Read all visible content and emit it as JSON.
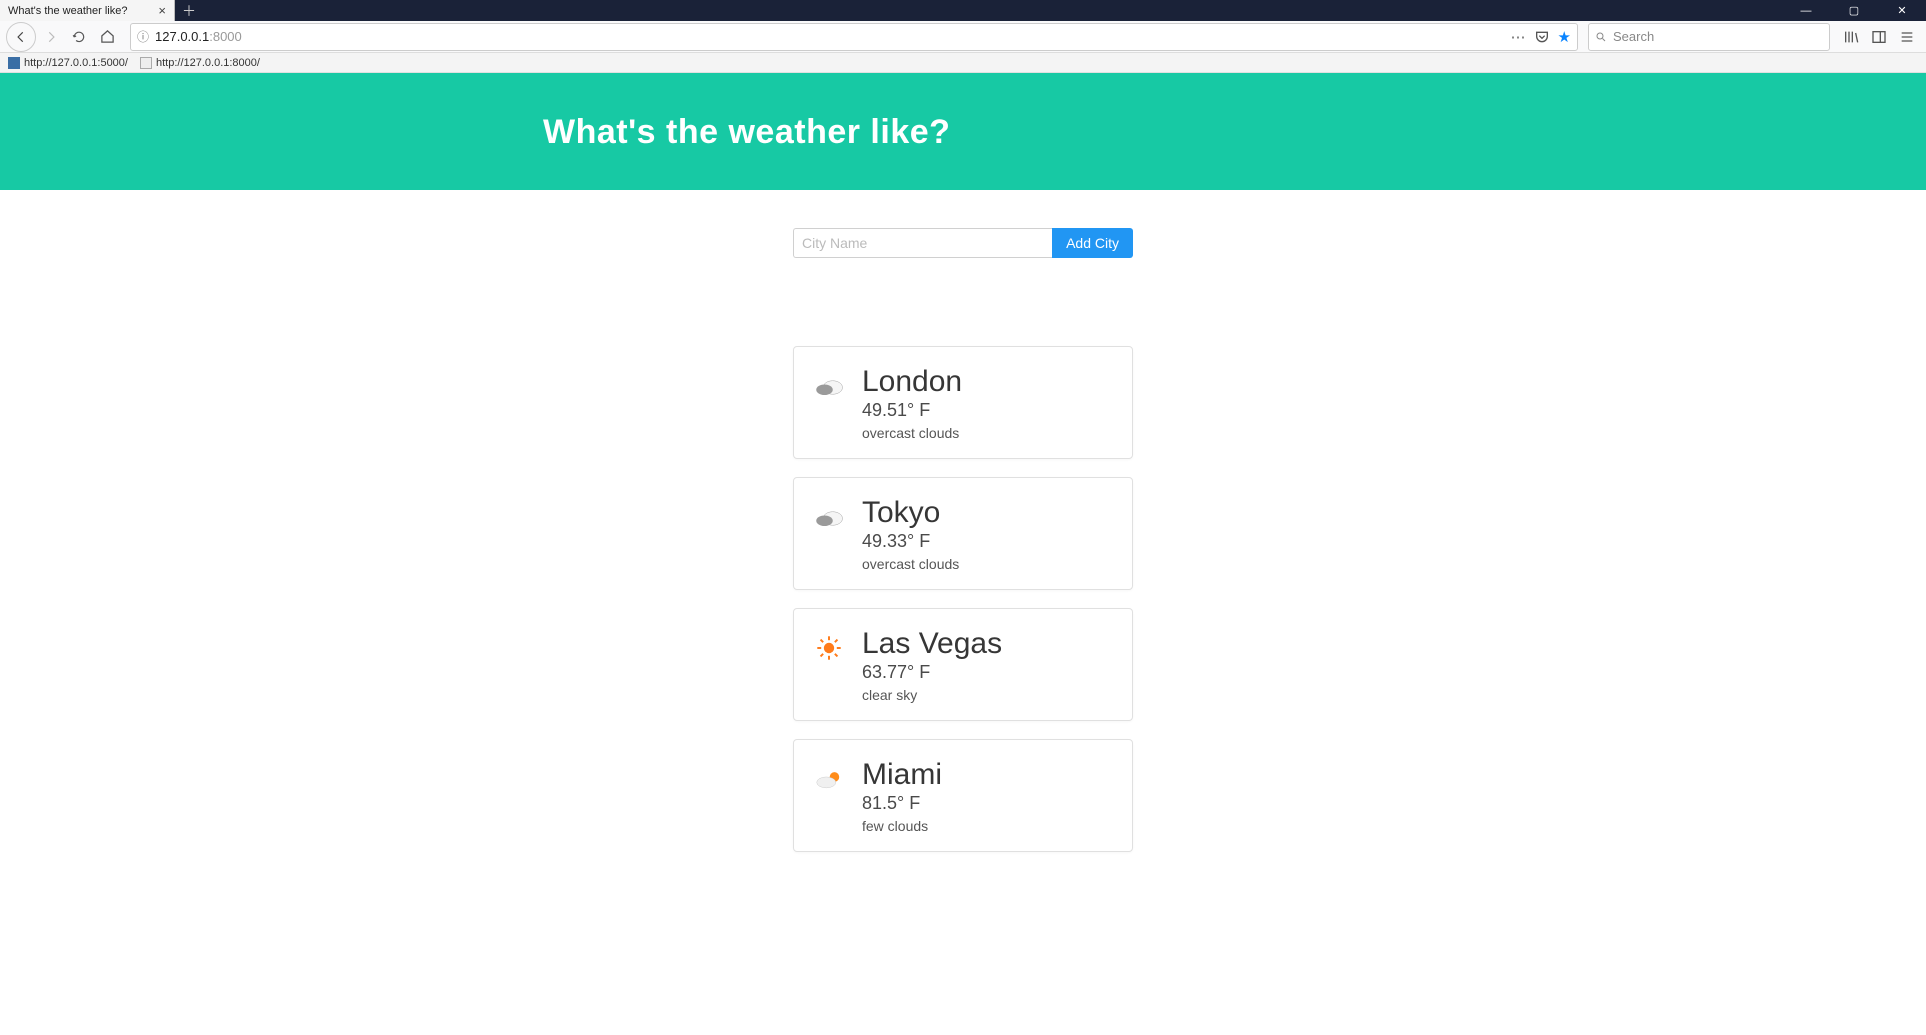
{
  "browser": {
    "tab_title": "What's the weather like?",
    "url_host": "127.0.0.1",
    "url_port": ":8000",
    "search_placeholder": "Search",
    "bookmarks": [
      "http://127.0.0.1:5000/",
      "http://127.0.0.1:8000/"
    ]
  },
  "page": {
    "hero_title": "What's the weather like?",
    "input_placeholder": "City Name",
    "add_button_label": "Add City",
    "cities": [
      {
        "name": "London",
        "temp": "49.51° F",
        "desc": "overcast clouds",
        "icon": "overcast"
      },
      {
        "name": "Tokyo",
        "temp": "49.33° F",
        "desc": "overcast clouds",
        "icon": "overcast"
      },
      {
        "name": "Las Vegas",
        "temp": "63.77° F",
        "desc": "clear sky",
        "icon": "clear"
      },
      {
        "name": "Miami",
        "temp": "81.5° F",
        "desc": "few clouds",
        "icon": "few"
      }
    ]
  },
  "colors": {
    "accent": "#17c9a4",
    "button": "#2196f3"
  }
}
